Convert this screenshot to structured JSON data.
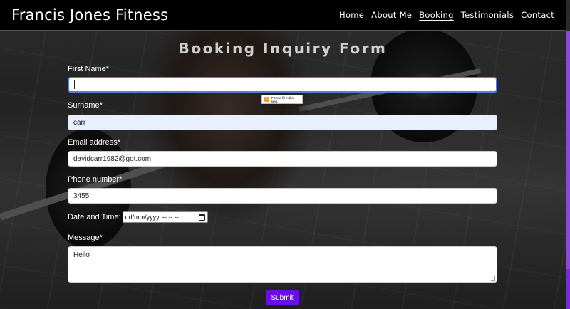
{
  "brand": "Francis Jones Fitness",
  "nav": {
    "items": [
      {
        "label": "Home"
      },
      {
        "label": "About Me"
      },
      {
        "label": "Booking"
      },
      {
        "label": "Testimonials"
      },
      {
        "label": "Contact"
      }
    ],
    "active": "Booking"
  },
  "form": {
    "title": "Booking Inquiry Form",
    "first_name": {
      "label": "First Name*",
      "value": ""
    },
    "surname": {
      "label": "Surname*",
      "value": "carr"
    },
    "email": {
      "label": "Email address*",
      "value": "davidcarr1982@got.com"
    },
    "phone": {
      "label": "Phone number*",
      "value": "3455"
    },
    "datetime": {
      "label": "Date and Time:",
      "placeholder": "dd/mm/yyyy, --:--:--"
    },
    "message": {
      "label": "Message*",
      "value": "Hello"
    },
    "validation_tooltip": "Please fill in this field.",
    "submit_label": "Submit"
  },
  "colors": {
    "navbar_bg": "#000000",
    "submit_bg": "#6a0dea",
    "autofill_bg": "#e8f0fe",
    "focus_border": "#5b7cd6",
    "scrollbar": "#7a2bd6"
  }
}
